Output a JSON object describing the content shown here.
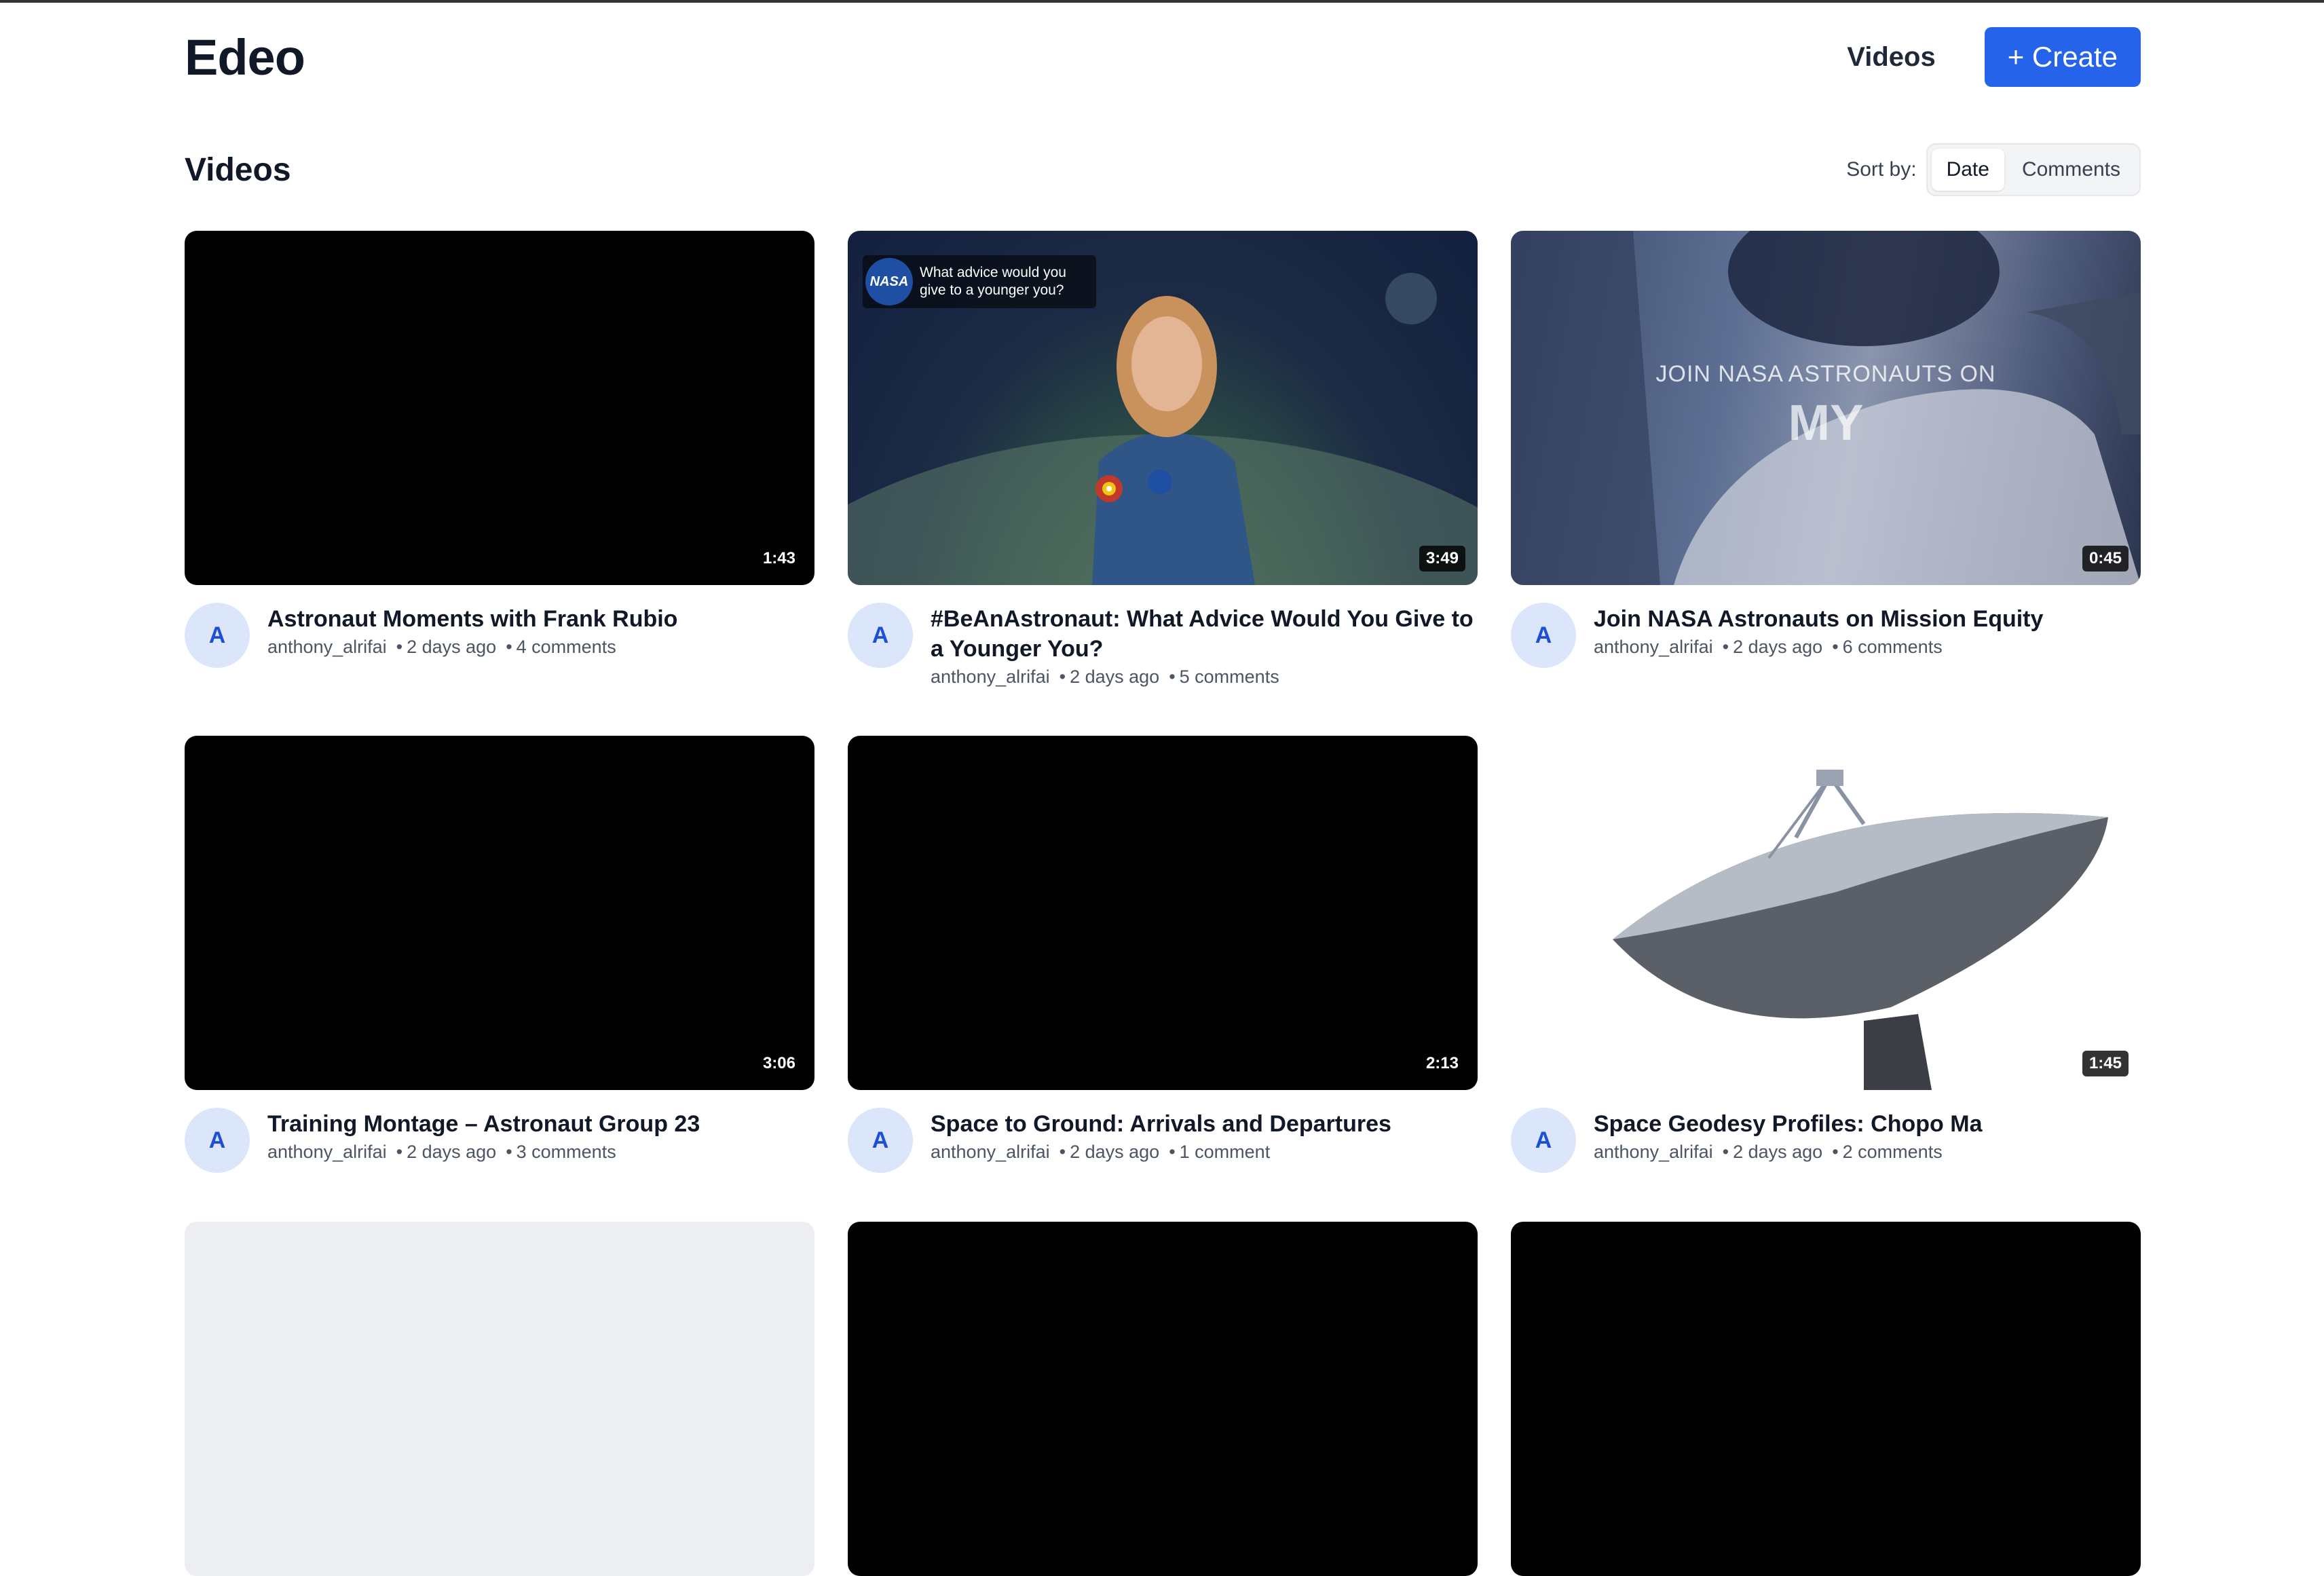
{
  "app": {
    "logo": "Edeo"
  },
  "nav": {
    "videos_label": "Videos",
    "create_label": "+ Create"
  },
  "toolbar": {
    "title": "Videos",
    "sort_label": "Sort by:",
    "sort_options": [
      "Date",
      "Comments"
    ],
    "selected": "Date"
  },
  "videos": [
    {
      "title": "Astronaut Moments with Frank Rubio",
      "author": "anthony_alrifai",
      "age": "2 days ago",
      "comments": "4 comments",
      "duration": "1:43",
      "avatar": "A",
      "thumbnail": "black"
    },
    {
      "title": "#BeAnAstronaut: What Advice Would You Give to a Younger You?",
      "author": "anthony_alrifai",
      "age": "2 days ago",
      "comments": "5 comments",
      "duration": "3:49",
      "avatar": "A",
      "thumbnail": "astronaut-portrait",
      "overlay_logo": "NASA",
      "overlay_caption": "What advice would you give to a younger you?"
    },
    {
      "title": "Join NASA Astronauts on Mission Equity",
      "author": "anthony_alrifai",
      "age": "2 days ago",
      "comments": "6 comments",
      "duration": "0:45",
      "avatar": "A",
      "thumbnail": "astronaut-cockpit",
      "overlay_text": "JOIN NASA ASTRONAUTS ON",
      "overlay_big": "MY"
    },
    {
      "title": "Training Montage – Astronaut Group 23",
      "author": "anthony_alrifai",
      "age": "2 days ago",
      "comments": "3 comments",
      "duration": "3:06",
      "avatar": "A",
      "thumbnail": "black"
    },
    {
      "title": "Space to Ground: Arrivals and Departures",
      "author": "anthony_alrifai",
      "age": "2 days ago",
      "comments": "1 comment",
      "duration": "2:13",
      "avatar": "A",
      "thumbnail": "black"
    },
    {
      "title": "Space Geodesy Profiles: Chopo Ma",
      "author": "anthony_alrifai",
      "age": "2 days ago",
      "comments": "2 comments",
      "duration": "1:45",
      "avatar": "A",
      "thumbnail": "radio-dish"
    },
    {
      "thumbnail": "light-gray"
    },
    {
      "thumbnail": "black"
    },
    {
      "thumbnail": "black"
    }
  ]
}
